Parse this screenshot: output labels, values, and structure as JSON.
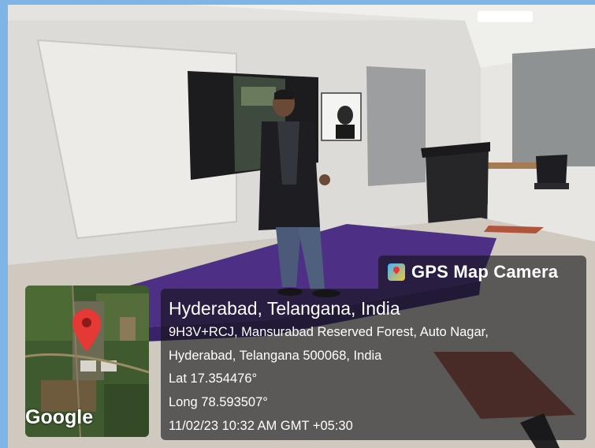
{
  "gps_badge": {
    "app_name": "GPS Map Camera",
    "icon": "gps-map-camera-app-icon"
  },
  "map": {
    "provider_label": "Google",
    "marker_icon": "map-pin-icon",
    "marker_color": "#e53935"
  },
  "location": {
    "city_line": "Hyderabad, Telangana, India",
    "address_line_1": "9H3V+RCJ, Mansurabad Reserved Forest, Auto Nagar,",
    "address_line_2": "Hyderabad, Telangana 500068, India",
    "latitude": "Lat 17.354476°",
    "longitude": "Long 78.593507°",
    "timestamp": "11/02/23 10:32 AM GMT +05:30"
  },
  "colors": {
    "outer_border": "#7fb5e6",
    "stage": "#4e2f86",
    "overlay": "#141418"
  }
}
